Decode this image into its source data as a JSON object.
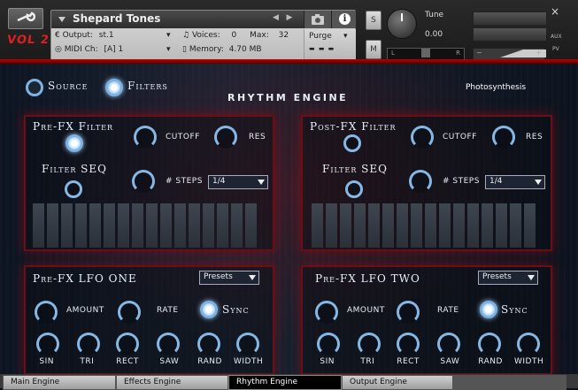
{
  "header": {
    "instrument_title": "Shepard Tones",
    "output_label": "Output:",
    "output_value": "st.1",
    "midi_label": "MIDI Ch:",
    "midi_value": "[A] 1",
    "voices_label": "Voices:",
    "voices_value": "0",
    "max_label": "Max:",
    "max_value": "32",
    "memory_label": "Memory:",
    "memory_value": "4.70 MB",
    "purge_label": "Purge",
    "logo_text": "VOL 2",
    "s_label": "S",
    "m_label": "M",
    "tune_label": "Tune",
    "tune_value": "0.00",
    "pan_left": "L",
    "pan_right": "R",
    "close": "×",
    "aux": "AUX",
    "pv": "PV"
  },
  "main": {
    "source_label": "Source",
    "filters_label": "Filters",
    "title": "RHYTHM ENGINE",
    "preset_name": "Photosynthesis",
    "pre_fx": {
      "title": "Pre-FX Filter",
      "cutoff": "CUTOFF",
      "res": "RES",
      "seq_title": "Filter SEQ",
      "steps_label": "# STEPS",
      "steps_value": "1/4"
    },
    "post_fx": {
      "title": "Post-FX Filter",
      "cutoff": "CUTOFF",
      "res": "RES",
      "seq_title": "Filter SEQ",
      "steps_label": "# STEPS",
      "steps_value": "1/4"
    },
    "lfo_one": {
      "title": "Pre-FX LFO ONE",
      "presets": "Presets",
      "amount": "AMOUNT",
      "rate": "RATE",
      "sync": "Sync",
      "shapes": [
        "SIN",
        "TRI",
        "RECT",
        "SAW",
        "RAND",
        "WIDTH"
      ]
    },
    "lfo_two": {
      "title": "Pre-FX LFO TWO",
      "presets": "Presets",
      "amount": "AMOUNT",
      "rate": "RATE",
      "sync": "Sync",
      "shapes": [
        "SIN",
        "TRI",
        "RECT",
        "SAW",
        "RAND",
        "WIDTH"
      ]
    }
  },
  "tabs": [
    "Main Engine",
    "Effects Engine",
    "Rhythm Engine",
    "Output Engine"
  ],
  "active_tab": "Rhythm Engine"
}
